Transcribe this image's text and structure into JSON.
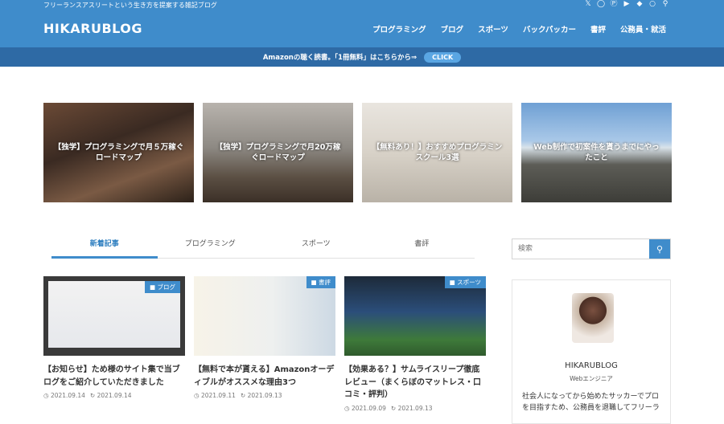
{
  "header": {
    "tagline": "フリーランスアスリートという生き方を提案する雑記ブログ",
    "logo": "HIKARUBLOG",
    "nav": [
      "プログラミング",
      "ブログ",
      "スポーツ",
      "バックパッカー",
      "書評",
      "公務員・就活"
    ],
    "social_icons": [
      "twitter-icon",
      "instagram-icon",
      "pinterest-icon",
      "youtube-icon",
      "feedly-icon",
      "rss-icon",
      "search-icon"
    ]
  },
  "notice": {
    "text": "Amazonの聴く読書。「1冊無料」はこちらから⇒",
    "button": "CLICK"
  },
  "featured": [
    {
      "title": "【独学】プログラミングで月５万稼ぐロードマップ"
    },
    {
      "title": "【独学】プログラミングで月20万稼ぐロードマップ"
    },
    {
      "title": "【無料あり！】おすすめプログラミンスクール3選"
    },
    {
      "title": "Web制作で初案件を貰うまでにやったこと"
    }
  ],
  "tabs": [
    "新着記事",
    "プログラミング",
    "スポーツ",
    "書評"
  ],
  "posts": [
    {
      "category": "ブログ",
      "title": "【お知らせ】ため様のサイト集で当ブログをご紹介していただきました",
      "published": "2021.09.14",
      "updated": "2021.09.14"
    },
    {
      "category": "書評",
      "title": "【無料で本が貰える】Amazonオーディブルがオススメな理由3つ",
      "published": "2021.09.11",
      "updated": "2021.09.13"
    },
    {
      "category": "スポーツ",
      "title": "【効果ある？】サムライスリープ徹底レビュー（まくらぼのマットレス・口コミ・評判）",
      "published": "2021.09.09",
      "updated": "2021.09.13"
    }
  ],
  "sidebar": {
    "search_placeholder": "検索",
    "profile_name": "HIKARUBLOG",
    "profile_role": "Webエンジニア",
    "profile_desc": "社会人になってから始めたサッカーでプロを目指すため、公務員を退職してフリーラ"
  },
  "colors": {
    "header": "#3f8ccb",
    "notice_bar": "#2e6aa5",
    "accent": "#3f8ccb"
  }
}
